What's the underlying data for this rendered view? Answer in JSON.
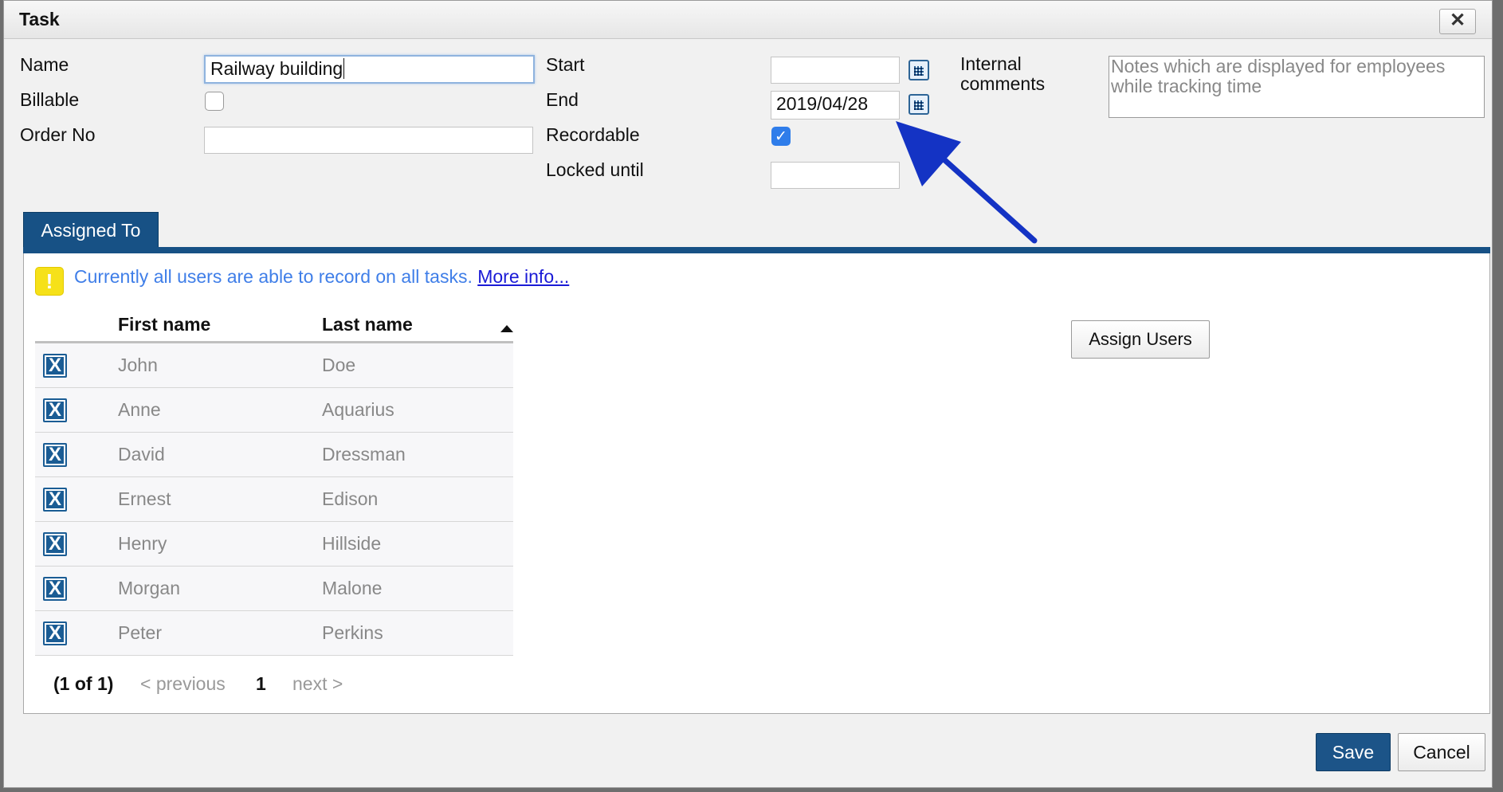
{
  "dialog": {
    "title": "Task",
    "close_icon": "close-icon"
  },
  "form": {
    "name_label": "Name",
    "name_value": "Railway building",
    "billable_label": "Billable",
    "billable_checked": false,
    "order_label": "Order No",
    "order_value": "",
    "start_label": "Start",
    "start_value": "",
    "end_label": "End",
    "end_value": "2019/04/28",
    "recordable_label": "Recordable",
    "recordable_checked": true,
    "locked_label": "Locked until",
    "locked_value": "",
    "comments_label_line1": "Internal",
    "comments_label_line2": "comments",
    "comments_placeholder": "Notes which are displayed for employees while tracking time",
    "calendar_icon": "calendar-icon"
  },
  "tabs": {
    "assigned_label": "Assigned To"
  },
  "assigned": {
    "info_text": "Currently all users are able to record on all tasks.",
    "info_link": "More info...",
    "col_first": "First name",
    "col_last": "Last name",
    "sort": "ascending",
    "rows": [
      {
        "first": "John",
        "last": "Doe"
      },
      {
        "first": "Anne",
        "last": "Aquarius"
      },
      {
        "first": "David",
        "last": "Dressman"
      },
      {
        "first": "Ernest",
        "last": "Edison"
      },
      {
        "first": "Henry",
        "last": "Hillside"
      },
      {
        "first": "Morgan",
        "last": "Malone"
      },
      {
        "first": "Peter",
        "last": "Perkins"
      }
    ],
    "remove_glyph": "X",
    "pager": {
      "summary": "(1 of 1)",
      "previous": "< previous",
      "page": "1",
      "next": "next >"
    },
    "assign_button": "Assign Users"
  },
  "footer": {
    "save": "Save",
    "cancel": "Cancel"
  },
  "colors": {
    "accent": "#175185",
    "arrow": "#1433c4",
    "link": "#1a1ad6"
  }
}
